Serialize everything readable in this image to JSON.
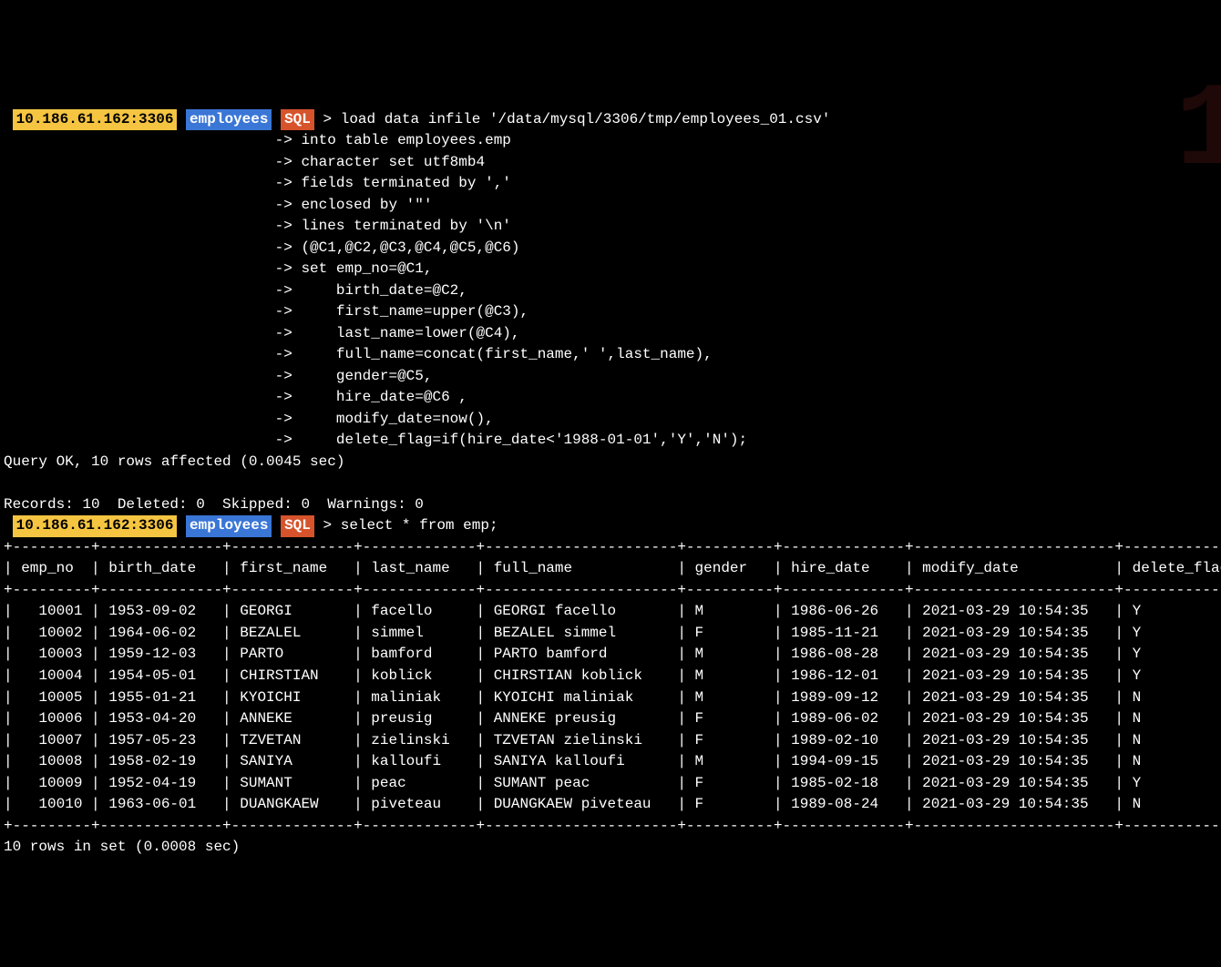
{
  "watermark": "1",
  "prompt1": {
    "host": "10.186.61.162:3306",
    "db": "employees",
    "mode": "SQL",
    "arrow": ">",
    "first_line": "load data infile '/data/mysql/3306/tmp/employees_01.csv'",
    "cont_arrow": "->",
    "cont_lines": [
      "into table employees.emp",
      "character set utf8mb4",
      "fields terminated by ','",
      "enclosed by '\"'",
      "lines terminated by '\\n'",
      "(@C1,@C2,@C3,@C4,@C5,@C6)",
      "set emp_no=@C1,",
      "    birth_date=@C2,",
      "    first_name=upper(@C3),",
      "    last_name=lower(@C4),",
      "    full_name=concat(first_name,' ',last_name),",
      "    gender=@C5,",
      "    hire_date=@C6 ,",
      "    modify_date=now(),",
      "    delete_flag=if(hire_date<'1988-01-01','Y','N');"
    ]
  },
  "result1_line1": "Query OK, 10 rows affected (0.0045 sec)",
  "result1_line2": "Records: 10  Deleted: 0  Skipped: 0  Warnings: 0",
  "prompt2": {
    "host": "10.186.61.162:3306",
    "db": "employees",
    "mode": "SQL",
    "arrow": ">",
    "line": "select * from emp;"
  },
  "table": {
    "columns": [
      "emp_no",
      "birth_date",
      "first_name",
      "last_name",
      "full_name",
      "gender",
      "hire_date",
      "modify_date",
      "delete_flag"
    ],
    "widths": [
      7,
      12,
      12,
      11,
      20,
      8,
      12,
      21,
      13
    ],
    "rows": [
      [
        "10001",
        "1953-09-02",
        "GEORGI",
        "facello",
        "GEORGI facello",
        "M",
        "1986-06-26",
        "2021-03-29 10:54:35",
        "Y"
      ],
      [
        "10002",
        "1964-06-02",
        "BEZALEL",
        "simmel",
        "BEZALEL simmel",
        "F",
        "1985-11-21",
        "2021-03-29 10:54:35",
        "Y"
      ],
      [
        "10003",
        "1959-12-03",
        "PARTO",
        "bamford",
        "PARTO bamford",
        "M",
        "1986-08-28",
        "2021-03-29 10:54:35",
        "Y"
      ],
      [
        "10004",
        "1954-05-01",
        "CHIRSTIAN",
        "koblick",
        "CHIRSTIAN koblick",
        "M",
        "1986-12-01",
        "2021-03-29 10:54:35",
        "Y"
      ],
      [
        "10005",
        "1955-01-21",
        "KYOICHI",
        "maliniak",
        "KYOICHI maliniak",
        "M",
        "1989-09-12",
        "2021-03-29 10:54:35",
        "N"
      ],
      [
        "10006",
        "1953-04-20",
        "ANNEKE",
        "preusig",
        "ANNEKE preusig",
        "F",
        "1989-06-02",
        "2021-03-29 10:54:35",
        "N"
      ],
      [
        "10007",
        "1957-05-23",
        "TZVETAN",
        "zielinski",
        "TZVETAN zielinski",
        "F",
        "1989-02-10",
        "2021-03-29 10:54:35",
        "N"
      ],
      [
        "10008",
        "1958-02-19",
        "SANIYA",
        "kalloufi",
        "SANIYA kalloufi",
        "M",
        "1994-09-15",
        "2021-03-29 10:54:35",
        "N"
      ],
      [
        "10009",
        "1952-04-19",
        "SUMANT",
        "peac",
        "SUMANT peac",
        "F",
        "1985-02-18",
        "2021-03-29 10:54:35",
        "Y"
      ],
      [
        "10010",
        "1963-06-01",
        "DUANGKAEW",
        "piveteau",
        "DUANGKAEW piveteau",
        "F",
        "1989-08-24",
        "2021-03-29 10:54:35",
        "N"
      ]
    ],
    "right_align": {
      "0": true
    }
  },
  "footer": "10 rows in set (0.0008 sec)"
}
